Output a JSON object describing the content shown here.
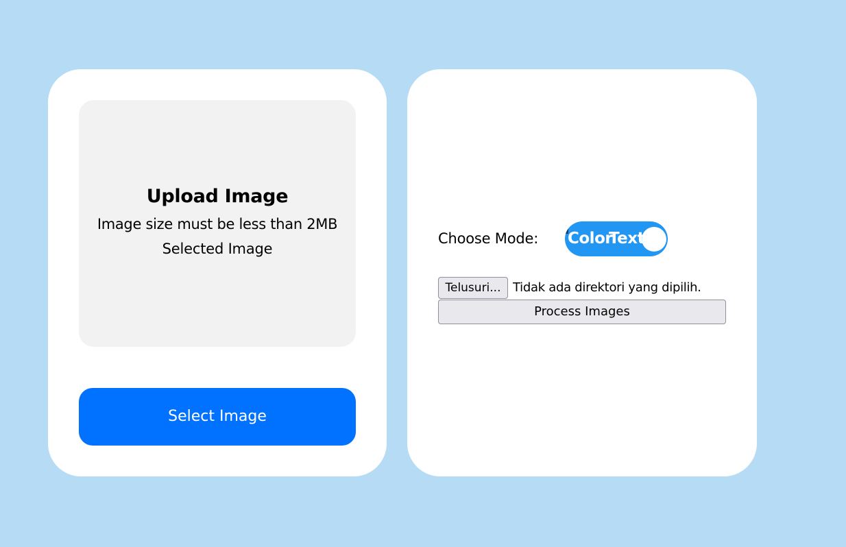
{
  "upload_card": {
    "title": "Upload Image",
    "note": "Image size must be less than 2MB",
    "selected_label": "Selected Image",
    "select_button_label": "Select Image"
  },
  "process_card": {
    "mode_label": "Choose Mode:",
    "toggle": {
      "option_a": "Color",
      "option_b": "Text"
    },
    "file_input": {
      "button_label": "Telusuri...",
      "status_text": "Tidak ada direktori yang dipilih."
    },
    "process_button_label": "Process Images"
  },
  "colors": {
    "page_background": "#b6dbf5",
    "card_background": "#ffffff",
    "upload_area_background": "#f2f2f2",
    "primary_button": "#0072ff",
    "toggle_background": "#2196f3"
  }
}
